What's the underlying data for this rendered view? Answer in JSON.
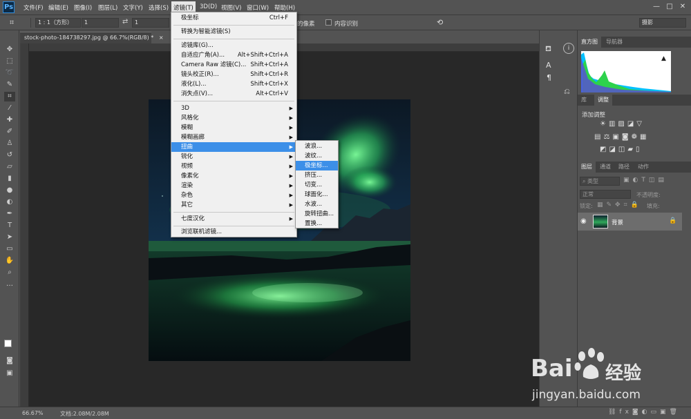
{
  "app": {
    "logo": "Ps"
  },
  "menubar": {
    "items": [
      "文件(F)",
      "编辑(E)",
      "图像(I)",
      "图层(L)",
      "文字(Y)",
      "选择(S)",
      "滤镜(T)",
      "3D(D)",
      "视图(V)",
      "窗口(W)",
      "帮助(H)"
    ],
    "active_index": 6
  },
  "window_controls": {
    "minimize": "—",
    "maximize": "□",
    "close": "✕"
  },
  "options": {
    "ratio": "1 : 1（方形）",
    "width": "1",
    "height": "1",
    "delete_pixels": "的像素",
    "content_aware": "内容识别",
    "workspace": "摄影"
  },
  "document": {
    "tab_title": "stock-photo-184738297.jpg @ 66.7%(RGB/8) *",
    "tab_close": "×"
  },
  "filter_menu": {
    "top": [
      {
        "label": "极坐标",
        "shortcut": "Ctrl+F"
      },
      {
        "label": "转换为智能滤镜(S)",
        "shortcut": ""
      }
    ],
    "gallery": [
      {
        "label": "滤镜库(G)...",
        "shortcut": ""
      },
      {
        "label": "自适应广角(A)...",
        "shortcut": "Alt+Shift+Ctrl+A"
      },
      {
        "label": "Camera Raw 滤镜(C)...",
        "shortcut": "Shift+Ctrl+A"
      },
      {
        "label": "镜头校正(R)...",
        "shortcut": "Shift+Ctrl+R"
      },
      {
        "label": "液化(L)...",
        "shortcut": "Shift+Ctrl+X"
      },
      {
        "label": "消失点(V)...",
        "shortcut": "Alt+Ctrl+V"
      }
    ],
    "groups": [
      "3D",
      "风格化",
      "模糊",
      "模糊画廊",
      "扭曲",
      "锐化",
      "视频",
      "像素化",
      "渲染",
      "杂色",
      "其它"
    ],
    "groups_highlight_index": 4,
    "plugins": [
      "七度汉化"
    ],
    "browse": "浏览联机滤镜..."
  },
  "distort_submenu": {
    "items": [
      "波浪...",
      "波纹...",
      "极坐标...",
      "挤压...",
      "切变...",
      "球面化...",
      "水波...",
      "旋转扭曲...",
      "置换..."
    ],
    "highlight_index": 2
  },
  "panels": {
    "histogram_tabs": [
      "直方图",
      "导航器"
    ],
    "adjust_tabs": [
      "库",
      "调整"
    ],
    "adjust_title": "添加调整",
    "layers_tabs": [
      "图层",
      "通道",
      "路径",
      "动作"
    ],
    "kind_placeholder": "类型",
    "blend_mode": "正常",
    "opacity_label": "不透明度:",
    "lock_label": "锁定:",
    "fill_label": "填充:",
    "layer_name": "背景"
  },
  "statusbar": {
    "zoom": "66.67%",
    "doc_info": "文档:2.08M/2.08M"
  },
  "watermark": {
    "brand": "Bai",
    "brand_tail": "经验",
    "url": "jingyan.baidu.com"
  },
  "colors": {
    "accent": "#3c8fe8",
    "ui_bg": "#535353",
    "canvas_bg": "#282828",
    "aurora": "#3fe06a"
  }
}
